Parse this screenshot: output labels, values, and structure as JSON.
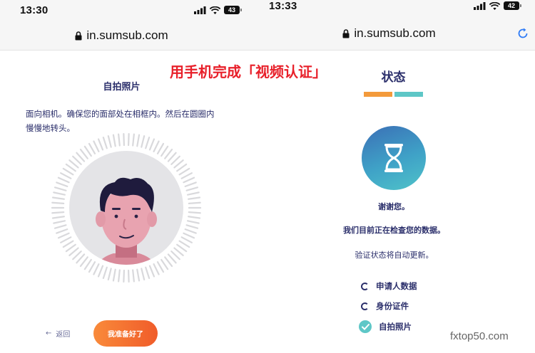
{
  "overlay_caption": "用手机完成「视频认证」",
  "watermark": "fxtop50.com",
  "left": {
    "status": {
      "time": "13:30",
      "battery": "43"
    },
    "url": "in.sumsub.com",
    "title": "自拍照片",
    "instruction_line1": "面向相机。确保您的面部处在相框内。然后在圆圈内",
    "instruction_line2": "慢慢地转头。",
    "back_label": "返回",
    "ready_button": "我准备好了"
  },
  "right": {
    "status": {
      "time": "13:33",
      "battery": "42"
    },
    "url": "in.sumsub.com",
    "title": "状态",
    "accent_colors": {
      "orange": "#f39a3b",
      "teal": "#5ec7c7"
    },
    "thanks": "谢谢您。",
    "checking": "我们目前正在检查您的数据。",
    "auto_update": "验证状态将自动更新。",
    "steps": [
      {
        "label": "申请人数据",
        "state": "pending"
      },
      {
        "label": "身份证件",
        "state": "pending"
      },
      {
        "label": "自拍照片",
        "state": "done"
      }
    ]
  }
}
